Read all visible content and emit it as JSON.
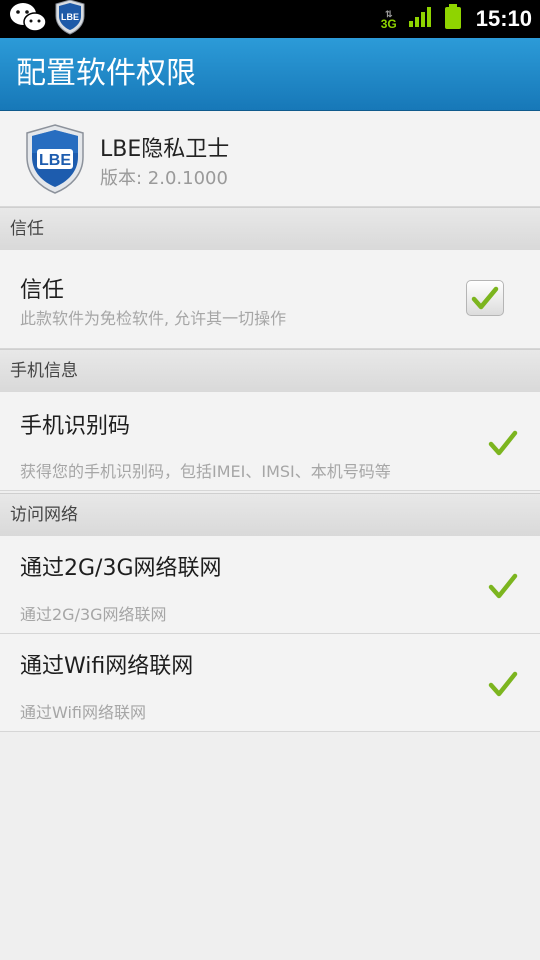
{
  "status_bar": {
    "time": "15:10",
    "network_label": "3G",
    "left_icons": [
      "wechat-icon",
      "lbe-shield-icon"
    ],
    "right_icons": [
      "3g-data-icon",
      "signal-bars-icon",
      "battery-icon"
    ],
    "shield_text": "LBE"
  },
  "title_bar": {
    "title": "配置软件权限"
  },
  "app": {
    "name": "LBE隐私卫士",
    "version": "版本: 2.0.1000",
    "icon_text": "LBE"
  },
  "sections": [
    {
      "header": "信任",
      "items": [
        {
          "title": "信任",
          "subtitle": "此款软件为免检软件, 允许其一切操作",
          "control": "checkbox",
          "checked": true
        }
      ]
    },
    {
      "header": "手机信息",
      "items": [
        {
          "title": "手机识别码",
          "subtitle": "获得您的手机识别码，包括IMEI、IMSI、本机号码等",
          "control": "allow-tick",
          "allowed": true
        }
      ]
    },
    {
      "header": "访问网络",
      "items": [
        {
          "title": "通过2G/3G网络联网",
          "subtitle": "通过2G/3G网络联网",
          "control": "allow-tick",
          "allowed": true
        },
        {
          "title": "通过Wifi网络联网",
          "subtitle": "通过Wifi网络联网",
          "control": "allow-tick",
          "allowed": true
        }
      ]
    }
  ],
  "colors": {
    "title_bar": "#1f8ccb",
    "tick_green": "#7cb51f",
    "status_bar": "#000000",
    "background": "#efefef"
  }
}
